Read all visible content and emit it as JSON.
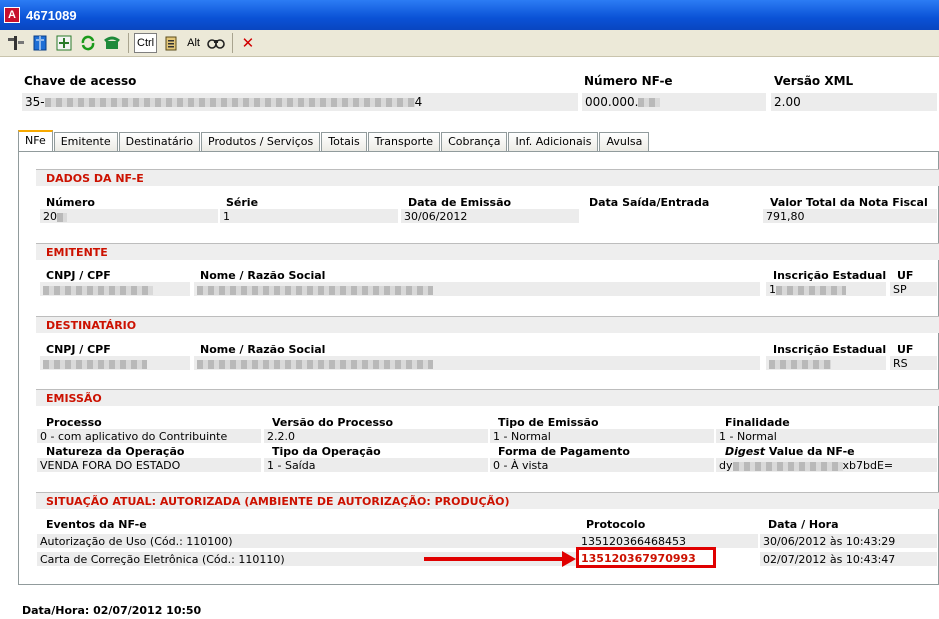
{
  "window": {
    "title": "4671089",
    "app_icon_letter": "A"
  },
  "toolbar": {
    "buttons": [
      "tools-icon",
      "book-icon",
      "fit-icon",
      "refresh-icon",
      "phone-icon"
    ],
    "ctrl_label": "Ctrl",
    "alt_label": "Alt",
    "close_label": "✕"
  },
  "header": {
    "chave_label": "Chave de acesso",
    "chave_value_start": "35-",
    "chave_value_end": "4",
    "numero_label": "Número NF-e",
    "numero_value": "000.000.",
    "versao_label": "Versão XML",
    "versao_value": "2.00"
  },
  "tabs": [
    "NFe",
    "Emitente",
    "Destinatário",
    "Produtos / Serviços",
    "Totais",
    "Transporte",
    "Cobrança",
    "Inf. Adicionais",
    "Avulsa"
  ],
  "dados": {
    "title": "DADOS DA NF-E",
    "numero_label": "Número",
    "numero_value": "20",
    "serie_label": "Série",
    "serie_value": "1",
    "emissao_label": "Data de Emissão",
    "emissao_value": "30/06/2012",
    "saida_label": "Data Saída/Entrada",
    "saida_value": "",
    "total_label": "Valor Total da Nota Fiscal",
    "total_value": "791,80"
  },
  "emitente": {
    "title": "EMITENTE",
    "cnpj_label": "CNPJ / CPF",
    "nome_label": "Nome / Razão Social",
    "ie_label": "Inscrição Estadual",
    "ie_value": "1",
    "uf_label": "UF",
    "uf_value": "SP"
  },
  "destinatario": {
    "title": "DESTINATÁRIO",
    "cnpj_label": "CNPJ / CPF",
    "nome_label": "Nome / Razão Social",
    "ie_label": "Inscrição Estadual",
    "uf_label": "UF",
    "uf_value": "RS"
  },
  "emissao": {
    "title": "EMISSÃO",
    "processo_label": "Processo",
    "processo_value": "0 - com aplicativo do Contribuinte",
    "versao_label": "Versão do Processo",
    "versao_value": "2.2.0",
    "tipo_label": "Tipo de Emissão",
    "tipo_value": "1 - Normal",
    "finalidade_label": "Finalidade",
    "finalidade_value": "1 - Normal",
    "natureza_label": "Natureza da Operação",
    "natureza_value": "VENDA FORA DO ESTADO",
    "tipo_op_label": "Tipo da Operação",
    "tipo_op_value": "1 - Saída",
    "pagamento_label": "Forma de Pagamento",
    "pagamento_value": "0 - À vista",
    "digest_label_italic": "Digest",
    "digest_label_rest": " Value da NF-e",
    "digest_value_start": "dy",
    "digest_value_end": "xb7bdE="
  },
  "situacao": {
    "title": "SITUAÇÃO ATUAL:  AUTORIZADA (AMBIENTE DE AUTORIZAÇÃO: PRODUÇÃO)",
    "eventos_label": "Eventos da NF-e",
    "protocolo_label": "Protocolo",
    "datahora_label": "Data / Hora",
    "rows": [
      {
        "evento": "Autorização de Uso (Cód.: 110100)",
        "protocolo": "135120366468453",
        "datahora": "30/06/2012 às 10:43:29"
      },
      {
        "evento": "Carta de Correção Eletrônica (Cód.: 110110)",
        "protocolo": "135120367970993",
        "datahora": "02/07/2012 às 10:43:47"
      }
    ]
  },
  "footer": {
    "datahora": "Data/Hora: 02/07/2012 10:50"
  }
}
